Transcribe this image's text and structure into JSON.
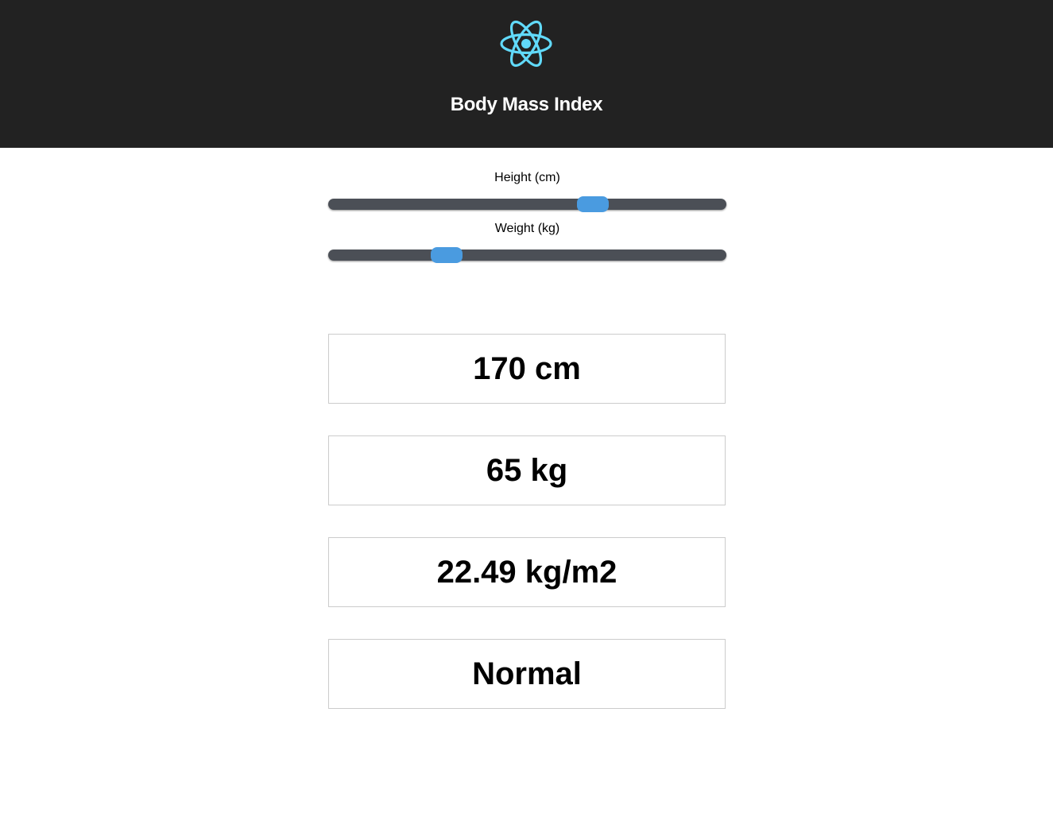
{
  "header": {
    "title": "Body Mass Index",
    "logo_icon": "react-atom-icon",
    "logo_color": "#61dafb",
    "background": "#222222"
  },
  "controls": {
    "height_label": "Height (cm)",
    "weight_label": "Weight (kg)",
    "thumb_color": "#4a9be0",
    "track_color": "#4b4f56",
    "height_value_fraction": 0.68,
    "weight_value_fraction": 0.28
  },
  "results": {
    "height": "170 cm",
    "weight": "65 kg",
    "bmi": "22.49 kg/m2",
    "category": "Normal"
  }
}
